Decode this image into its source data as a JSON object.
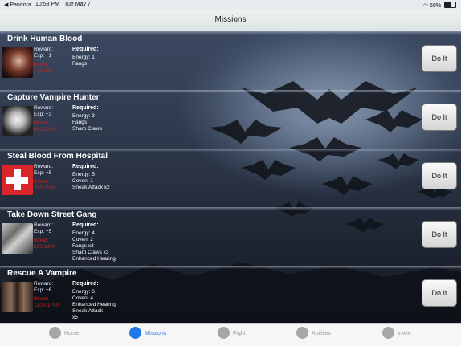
{
  "status_bar": {
    "carrier": "◀ Pandora",
    "time": "10:58 PM",
    "date": "Tue May 7",
    "battery": "60%",
    "battery_level": 0.6
  },
  "nav": {
    "title": "Missions"
  },
  "missions": [
    {
      "title": "Drink Human Blood",
      "reward_label": "Reward:",
      "exp": "Exp: +1",
      "blood_label": "Blood:",
      "blood": "100-300",
      "required_label": "Required:",
      "requirements": [
        "Energy: 1",
        "Fangs"
      ],
      "button": "Do It"
    },
    {
      "title": "Capture Vampire Hunter",
      "reward_label": "Reward:",
      "exp": "Exp: +3",
      "blood_label": "Blood:",
      "blood": "600-1000",
      "required_label": "Required:",
      "requirements": [
        "Energy: 3",
        "Fangs",
        "Sharp Claws"
      ],
      "button": "Do It"
    },
    {
      "title": "Steal Blood From Hospital",
      "reward_label": "Reward:",
      "exp": "Exp: +5",
      "blood_label": "Blood:",
      "blood": "750-1500",
      "required_label": "Required:",
      "requirements": [
        "Energy: 5",
        "Coven: 1",
        "Sneak Attack x2"
      ],
      "button": "Do It"
    },
    {
      "title": "Take Down Street Gang",
      "reward_label": "Reward:",
      "exp": "Exp: +5",
      "blood_label": "Blood:",
      "blood": "850-1400",
      "required_label": "Required:",
      "requirements": [
        "Energy: 4",
        "Coven: 2",
        "Fangs x3",
        "Sharp Claws x3",
        "Enhanced Hearing"
      ],
      "button": "Do It"
    },
    {
      "title": "Rescue A Vampire",
      "reward_label": "Reward:",
      "exp": "Exp: +6",
      "blood_label": "Blood:",
      "blood": "1200-1700",
      "required_label": "Required:",
      "requirements": [
        "Energy: 6",
        "Coven: 4",
        "Enhanced Hearing",
        "Sneak Attack",
        " x5"
      ],
      "button": "Do It"
    }
  ],
  "tabs": [
    {
      "label": "Home",
      "icon": "home-icon",
      "active": false
    },
    {
      "label": "Missions",
      "icon": "missions-icon",
      "active": true
    },
    {
      "label": "Fight",
      "icon": "fight-icon",
      "active": false
    },
    {
      "label": "Abilities",
      "icon": "abilities-icon",
      "active": false
    },
    {
      "label": "Invite",
      "icon": "invite-icon",
      "active": false
    }
  ],
  "colors": {
    "active_tab": "#1f7ae6",
    "blood_text": "#c0262a"
  }
}
